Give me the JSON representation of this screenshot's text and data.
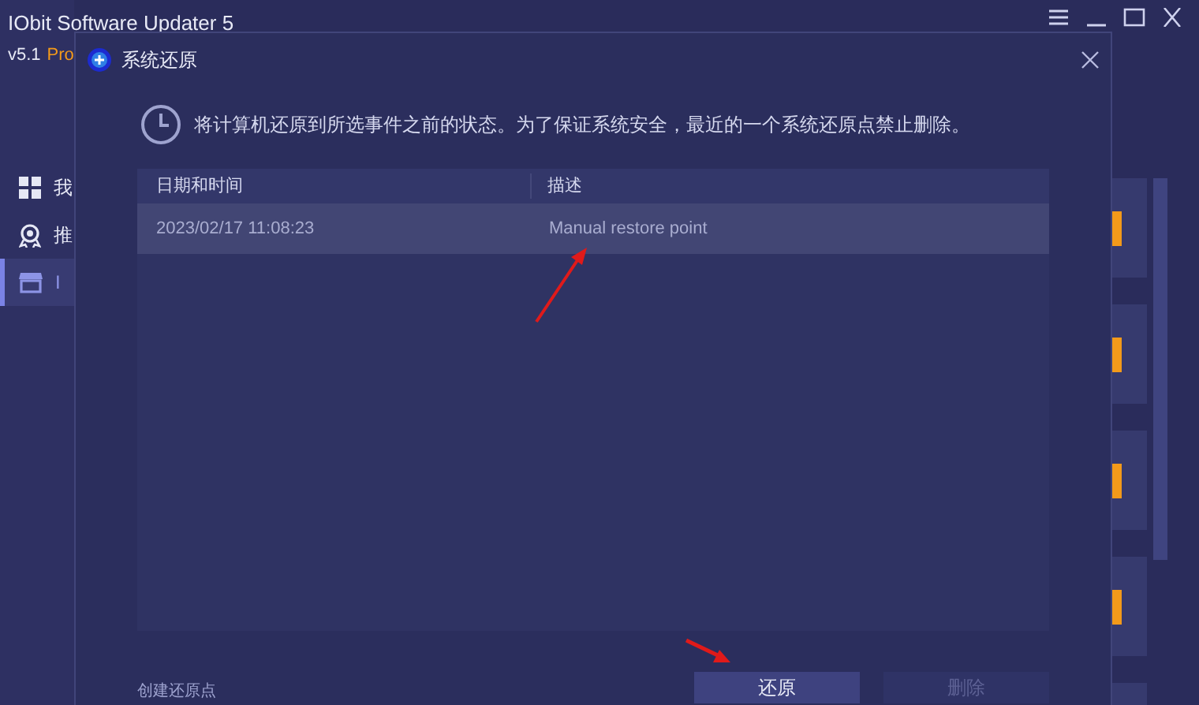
{
  "app": {
    "title": "IObit Software Updater 5",
    "version": "v5.1",
    "edition": "Pro"
  },
  "sidebar": {
    "items": [
      {
        "label": "我",
        "selected": false
      },
      {
        "label": "推",
        "selected": false
      },
      {
        "label": "I",
        "selected": true
      }
    ]
  },
  "dialog": {
    "title": "系统还原",
    "message": "将计算机还原到所选事件之前的状态。为了保证系统安全，最近的一个系统还原点禁止删除。",
    "table": {
      "columns": [
        "日期和时间",
        "描述"
      ],
      "rows": [
        {
          "cells": [
            "2023/02/17 11:08:23",
            "Manual restore point"
          ],
          "selected": true
        }
      ]
    },
    "create_link": "创建还原点",
    "buttons": [
      {
        "label": "还原",
        "disabled": false
      },
      {
        "label": "删除",
        "disabled": true
      }
    ]
  }
}
